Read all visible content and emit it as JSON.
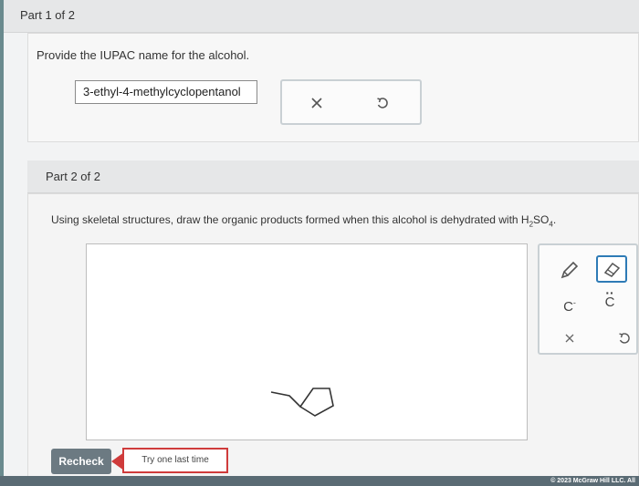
{
  "part1": {
    "header": "Part 1 of 2",
    "prompt": "Provide the IUPAC name for the alcohol.",
    "answer_value": "3-ethyl-4-methylcyclopentanol",
    "clear_icon": "times-icon",
    "undo_icon": "undo-icon"
  },
  "part2": {
    "header": "Part 2 of 2",
    "prompt_main": "Using skeletal structures, draw the organic products formed when this alcohol is dehydrated with H",
    "sub_2": "2",
    "so": "SO",
    "sub_4": "4",
    "prompt_end": ".",
    "tools": {
      "pencil_icon": "pencil-icon",
      "eraser_icon": "eraser-icon",
      "carbanion_label": "C",
      "carbanion_charge": "-",
      "carbene_label": "C",
      "carbene_dots": "··",
      "clear_icon": "times-icon",
      "undo_icon": "undo-icon"
    }
  },
  "actions": {
    "recheck_label": "Recheck",
    "try_label": "Try one last time"
  },
  "footer": {
    "copyright": "© 2023 McGraw Hill LLC. All"
  }
}
